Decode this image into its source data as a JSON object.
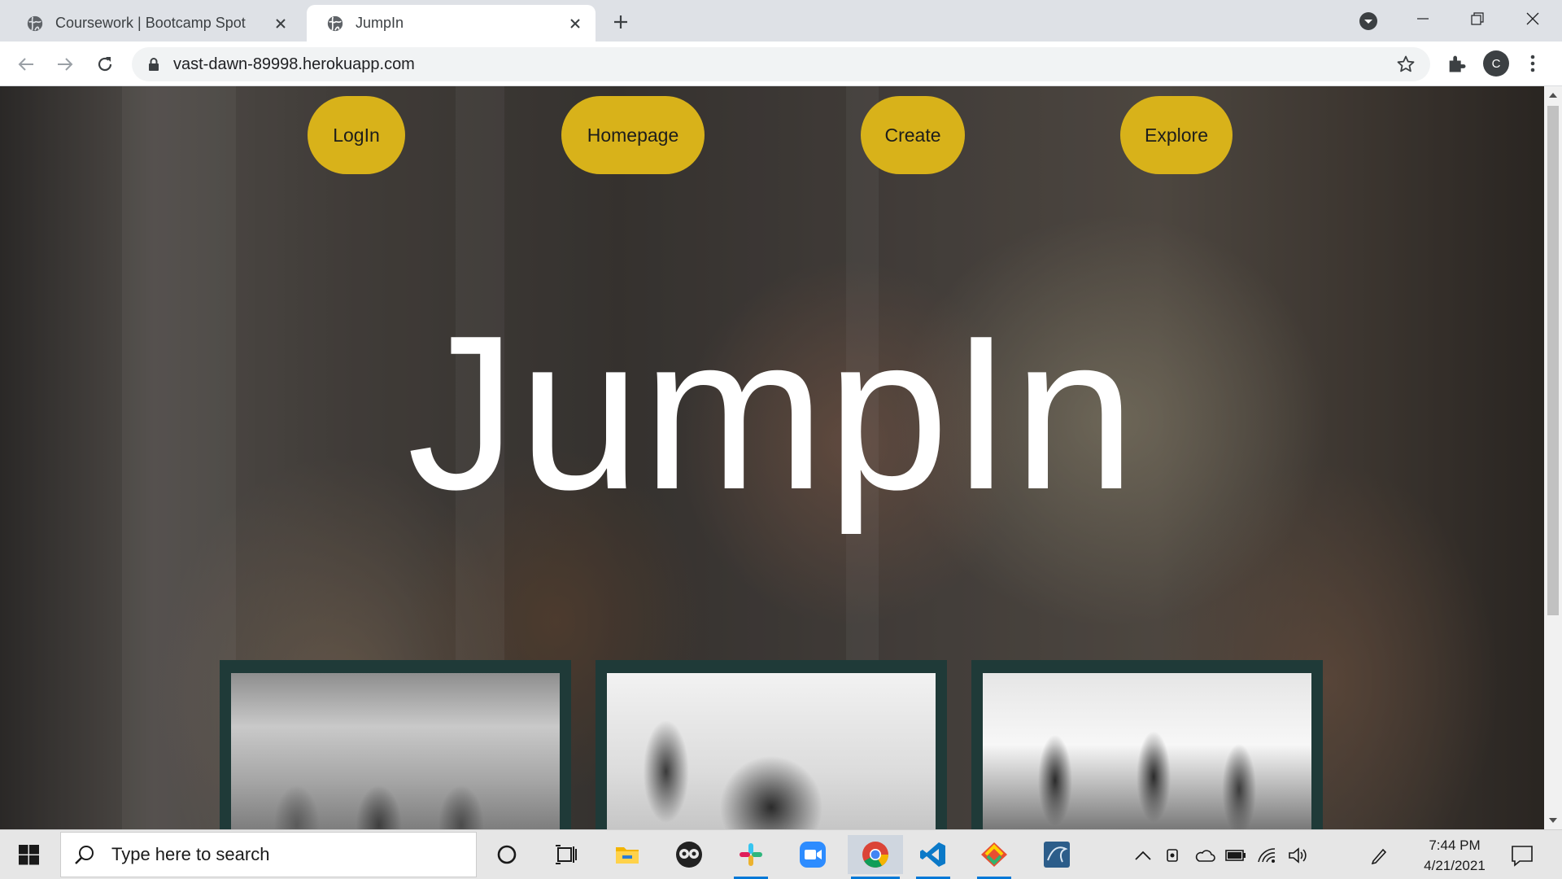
{
  "browser": {
    "tabs": [
      {
        "title": "Coursework | Bootcamp Spot",
        "active": false
      },
      {
        "title": "JumpIn",
        "active": true
      }
    ],
    "url": "vast-dawn-89998.herokuapp.com",
    "profile_initial": "C"
  },
  "page": {
    "nav": {
      "login": "LogIn",
      "homepage": "Homepage",
      "create": "Create",
      "explore": "Explore"
    },
    "headline": "JumpIn",
    "colors": {
      "nav_button": "#d8b21a",
      "card_frame": "#1f3a38",
      "headline_text": "#ffffff"
    },
    "cards": [
      {
        "image": "group-sitting-in-park-photo"
      },
      {
        "image": "basketball-game-photo"
      },
      {
        "image": "hikers-on-hill-photo"
      }
    ]
  },
  "taskbar": {
    "search_placeholder": "Type here to search",
    "time": "7:44 PM",
    "date": "4/21/2021",
    "apps": [
      "cortana-icon",
      "task-view-icon",
      "file-explorer-icon",
      "app-icon",
      "slack-icon",
      "zoom-icon",
      "chrome-icon",
      "vscode-icon",
      "git-icon",
      "mysql-icon"
    ]
  }
}
